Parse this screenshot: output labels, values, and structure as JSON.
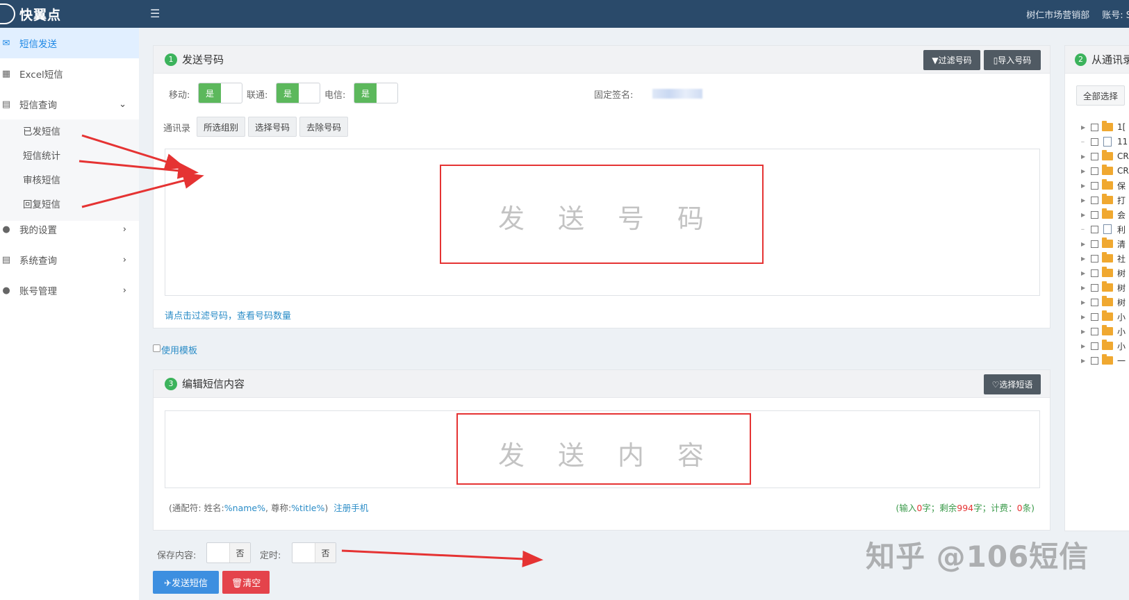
{
  "topbar": {
    "logo_text": "快翼点",
    "menu_icon": "☰",
    "org_name": "树仁市场营销部",
    "account_label": "账号: S"
  },
  "sidebar": {
    "items": [
      {
        "label": "短信发送",
        "icon": "envelope-icon"
      },
      {
        "label": "Excel短信",
        "icon": "excel-icon"
      },
      {
        "label": "短信查询",
        "icon": "search-list-icon"
      },
      {
        "label": "我的设置",
        "icon": "user-icon"
      },
      {
        "label": "系统查询",
        "icon": "search-list-icon"
      },
      {
        "label": "账号管理",
        "icon": "user-icon"
      }
    ],
    "sub_items": [
      "已发短信",
      "短信统计",
      "审核短信",
      "回复短信"
    ]
  },
  "send_panel": {
    "step": "1",
    "title": "发送号码",
    "filter_button": "▼过滤号码",
    "import_button": "▯导入号码",
    "mobile_label": "移动:",
    "unicom_label": "联通:",
    "telecom_label": "电信:",
    "toggle_on": "是",
    "signature_label": "固定签名:",
    "contacts_label": "通讯录",
    "group_button": "所选组别",
    "pick_button": "选择号码",
    "remove_button": "去除号码",
    "placeholder": "发送号码",
    "hint": "请点击过滤号码，查看号码数量"
  },
  "template": {
    "label": "使用模板"
  },
  "content_panel": {
    "step": "3",
    "title": "编辑短信内容",
    "pick_phrase_button": "♡选择短语",
    "placeholder": "发送内容",
    "wildcard_prefix": "(通配符: 姓名:",
    "name_var": "%name%",
    "title_prefix": ", 尊称:",
    "title_var": "%title%",
    "wildcard_suffix": ")",
    "register_link": "注册手机",
    "count_prefix": "(输入",
    "count_input": "0",
    "count_mid1": "字；剩余",
    "count_remaining": "994",
    "count_mid2": "字；计费：",
    "count_fee": "0",
    "count_suffix": "条)"
  },
  "bottom": {
    "save_label": "保存内容:",
    "timer_label": "定时:",
    "toggle_off": "否",
    "send_button": "✈发送短信",
    "clear_button": "🗑清空"
  },
  "contacts_panel": {
    "step": "2",
    "title": "从通讯录",
    "select_all": "全部选择",
    "tree": [
      {
        "type": "folder",
        "label": "1["
      },
      {
        "type": "doc",
        "label": "11"
      },
      {
        "type": "folder",
        "label": "CR"
      },
      {
        "type": "folder",
        "label": "CR"
      },
      {
        "type": "folder",
        "label": "保"
      },
      {
        "type": "folder",
        "label": "打"
      },
      {
        "type": "folder",
        "label": "会"
      },
      {
        "type": "doc",
        "label": "利"
      },
      {
        "type": "folder",
        "label": "清"
      },
      {
        "type": "folder",
        "label": "社"
      },
      {
        "type": "folder",
        "label": "树"
      },
      {
        "type": "folder",
        "label": "树"
      },
      {
        "type": "folder",
        "label": "树"
      },
      {
        "type": "folder",
        "label": "小"
      },
      {
        "type": "folder",
        "label": "小"
      },
      {
        "type": "folder",
        "label": "小"
      },
      {
        "type": "folder",
        "label": "一"
      }
    ]
  },
  "watermark": "知乎 @106短信",
  "colors": {
    "topbar": "#2a4a6a",
    "accent_blue": "#3d8fe0",
    "toggle_green": "#5cb85c",
    "danger_red": "#e4434b",
    "annotation_red": "#e53333"
  }
}
